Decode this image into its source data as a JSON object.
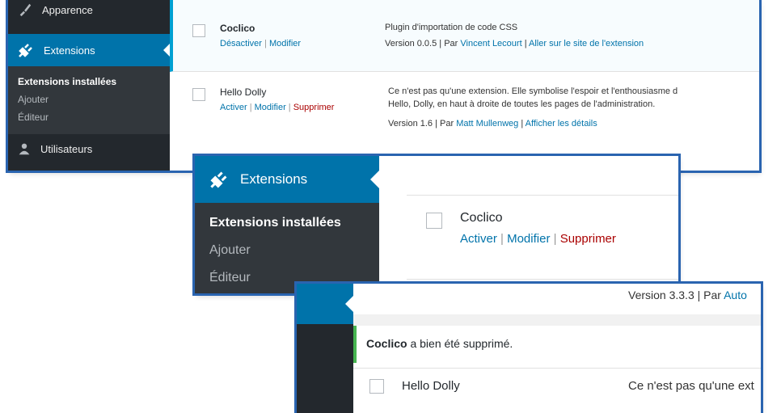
{
  "panel1": {
    "menu": {
      "appearance": "Apparence",
      "extensions": "Extensions",
      "submenu": [
        "Extensions installées",
        "Ajouter",
        "Éditeur"
      ],
      "users": "Utilisateurs"
    },
    "plugins": [
      {
        "name": "Coclico",
        "actions": [
          "Désactiver",
          "Modifier"
        ],
        "description": "Plugin d'importation de code CSS",
        "version": "Version 0.0.5",
        "by": "Par",
        "author": "Vincent Lecourt",
        "link": "Aller sur le site de l'extension"
      },
      {
        "name": "Hello Dolly",
        "actions": [
          "Activer",
          "Modifier",
          "Supprimer"
        ],
        "description_line1": "Ce n'est pas qu'une extension. Elle symbolise l'espoir et l'enthousiasme d",
        "description_line2": "Hello, Dolly, en haut à droite de toutes les pages de l'administration.",
        "version": "Version 1.6",
        "by": "Par",
        "author": "Matt Mullenweg",
        "link": "Afficher les détails"
      }
    ]
  },
  "panel2": {
    "menu": {
      "extensions": "Extensions",
      "submenu": [
        "Extensions installées",
        "Ajouter",
        "Éditeur"
      ]
    },
    "plugin": {
      "name": "Coclico",
      "actions": [
        "Activer",
        "Modifier",
        "Supprimer"
      ]
    }
  },
  "panel3": {
    "version": "Version 3.3.3",
    "by": "Par",
    "author_partial": "Auto",
    "notice_name": "Coclico",
    "notice_text": " a bien été supprimé.",
    "plugin_name": "Hello Dolly",
    "description_partial": "Ce n'est pas qu'une ext"
  },
  "colors": {
    "accent": "#0073aa",
    "sidebar": "#23282d",
    "delete": "#aa0000",
    "frame": "#2a64b0"
  }
}
